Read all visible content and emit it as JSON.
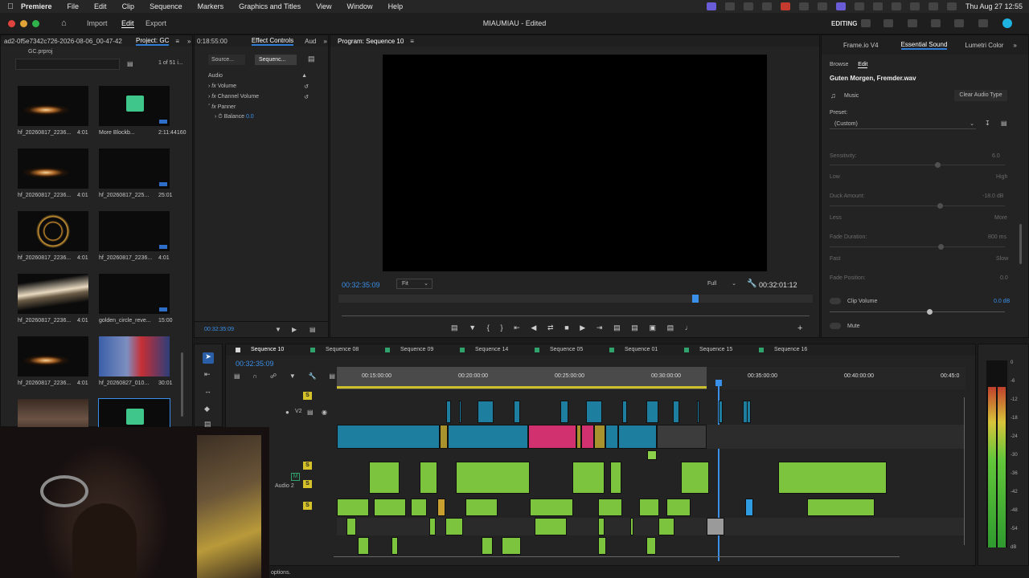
{
  "menubar": {
    "app": "Premiere",
    "items": [
      "File",
      "Edit",
      "Clip",
      "Sequence",
      "Markers",
      "Graphics and Titles",
      "View",
      "Window",
      "Help"
    ],
    "clock": "Thu Aug 27  12:55"
  },
  "titlebar": {
    "import": "Import",
    "edit": "Edit",
    "export": "Export",
    "title": "MIAUMIAU - Edited",
    "workspace": "EDITING"
  },
  "project": {
    "header_left": "ad2-0f5e7342c726-2026-08-06_00-47-42",
    "tab": "Project: GC",
    "file": "GC.prproj",
    "count": "1 of 51 i...",
    "items": [
      {
        "name": "hf_20260817_2236...",
        "dur": "4:01",
        "kind": "flare"
      },
      {
        "name": "More Blockb...",
        "dur": "2:11:44160",
        "kind": "audio"
      },
      {
        "name": "hf_20260817_2236...",
        "dur": "4:01",
        "kind": "flare"
      },
      {
        "name": "hf_20260817_225...",
        "dur": "25:01",
        "kind": "dark"
      },
      {
        "name": "hf_20260817_2236...",
        "dur": "4:01",
        "kind": "gold"
      },
      {
        "name": "hf_20260817_2236...",
        "dur": "4:01",
        "kind": "dark"
      },
      {
        "name": "hf_20260817_2236...",
        "dur": "4:01",
        "kind": "beam"
      },
      {
        "name": "golden_circle_reve...",
        "dur": "15:00",
        "kind": "dark"
      },
      {
        "name": "hf_20260817_2236...",
        "dur": "4:01",
        "kind": "flare"
      },
      {
        "name": "hf_20260827_010...",
        "dur": "30:01",
        "kind": "person"
      },
      {
        "name": "",
        "dur": "",
        "kind": "hall"
      },
      {
        "name": "",
        "dur": "",
        "kind": "audio"
      }
    ]
  },
  "effects": {
    "tab_left_time": "0:18:55:00",
    "tab": "Effect Controls",
    "tab_right": "Aud",
    "source_btn": "Source...",
    "sequence_btn": "Sequenc...",
    "section": "Audio",
    "rows": [
      "Volume",
      "Channel Volume",
      "Panner"
    ],
    "balance": "Balance",
    "balance_val": "0.0",
    "timecode": "00:32:35:09"
  },
  "program": {
    "title": "Program: Sequence 10",
    "timecode": "00:32:35:09",
    "fit": "Fit",
    "quality": "Full",
    "duration": "00:32:01:12"
  },
  "essential": {
    "tabs": [
      "Frame.io V4",
      "Essential Sound",
      "Lumetri Color"
    ],
    "sub_tabs": [
      "Browse",
      "Edit"
    ],
    "clip_name": "Guten Morgen, Fremder.wav",
    "type": "Music",
    "clear": "Clear Audio Type",
    "preset_label": "Preset:",
    "preset": "(Custom)",
    "sensitivity": "Sensitivity:",
    "sensitivity_val": "6.0",
    "low": "Low",
    "high": "High",
    "duck": "Duck Amount:",
    "duck_val": "-18.0 dB",
    "less": "Less",
    "more": "More",
    "fade_dur": "Fade Duration:",
    "fade_dur_val": "800 ms",
    "fast": "Fast",
    "slow": "Slow",
    "fade_pos": "Fade Position:",
    "fade_pos_val": "0.0",
    "clip_volume": "Clip Volume",
    "clip_volume_val": "0.0 dB",
    "mute": "Mute"
  },
  "timeline": {
    "tabs": [
      "Sequence 10",
      "Sequence 08",
      "Sequence 09",
      "Sequence 14",
      "Sequence 05",
      "Sequence 01",
      "Sequence 15",
      "Sequence 16"
    ],
    "tab_colors": [
      "#d6d6d6",
      "#2fa36b",
      "#2fa36b",
      "#2fa36b",
      "#2fa36b",
      "#2fa36b",
      "#2fa36b",
      "#2fa36b"
    ],
    "timecode": "00:32:35:09",
    "ruler": [
      "00:15:00:00",
      "00:20:00:00",
      "00:25:00:00",
      "00:30:00:00",
      "00:35:00:00",
      "00:40:00:00",
      "00:45:0"
    ],
    "track_labels": [
      "V2",
      "Audio 2"
    ],
    "meter_scale": [
      "0",
      "-6",
      "-12",
      "-18",
      "-24",
      "-30",
      "-36",
      "-42",
      "-48",
      "-54",
      "dB"
    ],
    "meter_level": 0.86,
    "status": "options."
  }
}
